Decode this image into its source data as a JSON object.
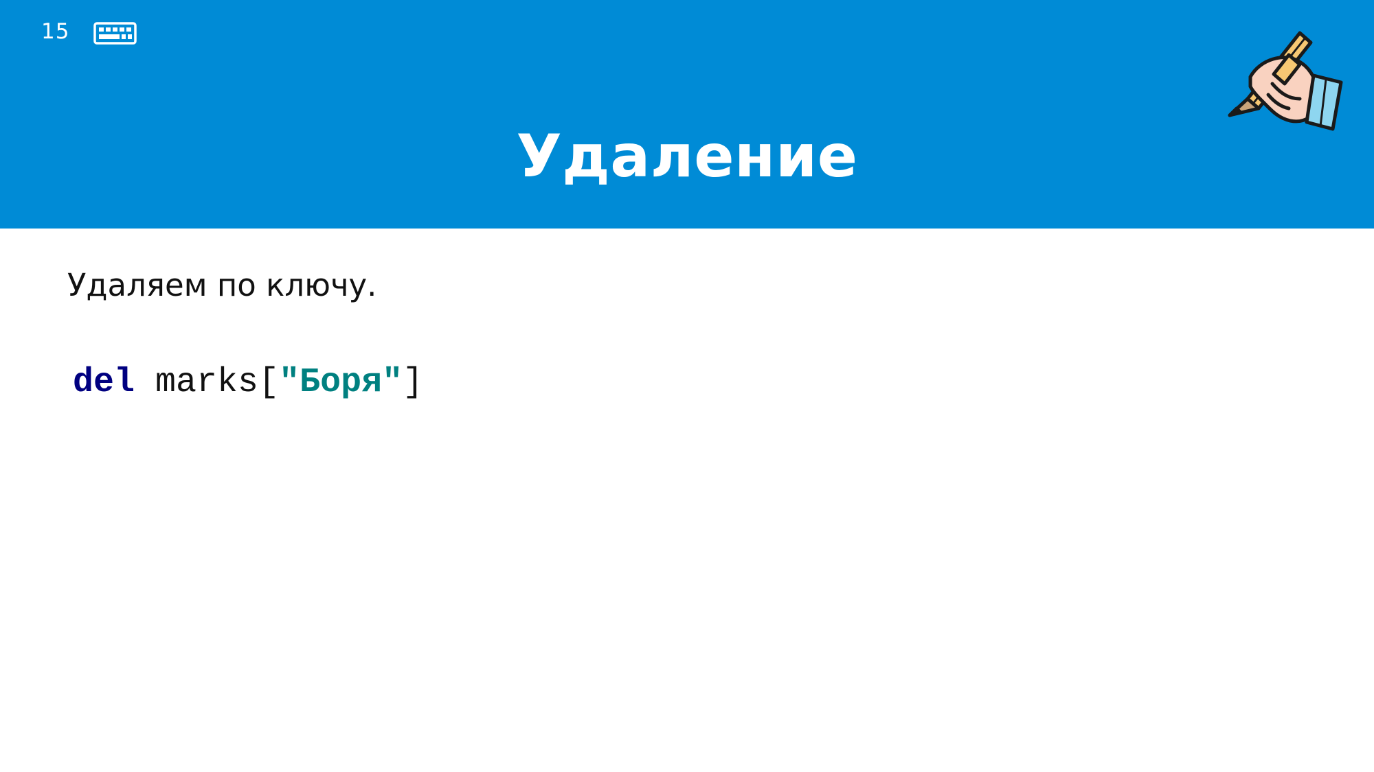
{
  "slide": {
    "number": "15",
    "title": "Удаление",
    "subtitle": "Удаляем по ключу.",
    "icons": {
      "keyboard": "keyboard-icon",
      "hand": "hand-writing-pencil-icon"
    }
  },
  "code": {
    "keyword": "del",
    "space": " ",
    "name": "marks",
    "open": "[",
    "string": "\"Боря\"",
    "close": "]"
  },
  "colors": {
    "header_bg": "#008bd6",
    "keyword": "#000080",
    "string": "#008080"
  }
}
